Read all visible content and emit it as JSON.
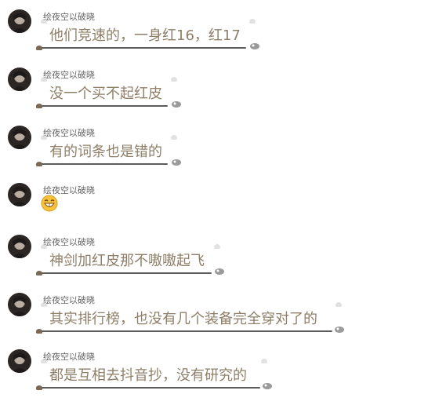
{
  "messages": [
    {
      "sender": "绘夜空以破晓",
      "text": "他们竞速的，一身红16，红17"
    },
    {
      "sender": "绘夜空以破晓",
      "text": "没一个买不起红皮"
    },
    {
      "sender": "绘夜空以破晓",
      "text": "有的词条也是错的"
    },
    {
      "sender": "绘夜空以破晓",
      "emoji": "grinning-face-emoji"
    },
    {
      "sender": "绘夜空以破晓",
      "text": "神剑加红皮那不嗷嗷起飞"
    },
    {
      "sender": "绘夜空以破晓",
      "text": "其实排行榜，也没有几个装备完全穿对了的"
    },
    {
      "sender": "绘夜空以破晓",
      "text": "都是互相去抖音抄，没有研究的"
    }
  ]
}
